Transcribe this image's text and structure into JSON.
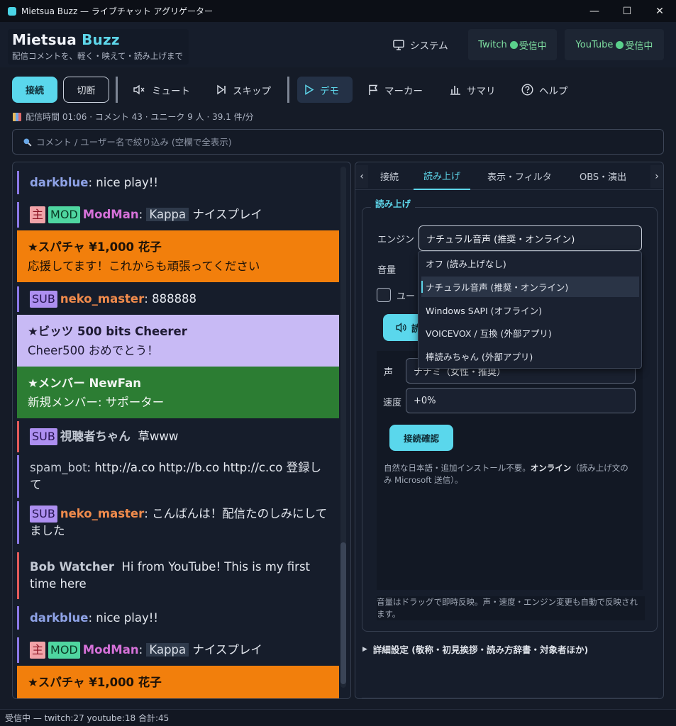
{
  "window": {
    "title": "Mietsua Buzz — ライブチャット アグリゲーター"
  },
  "brand": {
    "name": "Mietsua",
    "accent": "Buzz",
    "tagline": "配信コメントを、軽く・映えて・読み上げまで"
  },
  "header": {
    "system_label": "システム",
    "twitch_label": "Twitch",
    "twitch_status": "受信中",
    "youtube_label": "YouTube",
    "youtube_status": "受信中"
  },
  "toolbar": {
    "connect": "接続",
    "disconnect": "切断",
    "mute": "ミュート",
    "skip": "スキップ",
    "demo": "デモ",
    "marker": "マーカー",
    "summary": "サマリ",
    "help": "ヘルプ"
  },
  "stats": {
    "text": "配信時間 01:06 · コメント 43 · ユニーク 9 人 · 39.1 件/分"
  },
  "search": {
    "placeholder": "コメント / ユーザー名で絞り込み (空欄で全表示)"
  },
  "chat": {
    "m1": {
      "user": "darkblue",
      "text": ": nice play!!"
    },
    "m2": {
      "badge_host": "主",
      "badge_mod": "MOD",
      "user": "ModMan",
      "emote": "Kappa",
      "text": "ナイスプレイ"
    },
    "m3": {
      "title": "★スパチャ ¥1,000  花子",
      "text": "応援してます！これからも頑張ってください"
    },
    "m4": {
      "badge_sub": "SUB",
      "user": "neko_master",
      "text": ": 888888"
    },
    "m5": {
      "title": "★ビッツ 500 bits  Cheerer",
      "text": "Cheer500 おめでとう！"
    },
    "m6": {
      "title": "★メンバー  NewFan",
      "text": "新規メンバー: サポーター"
    },
    "m7": {
      "badge_sub": "SUB",
      "user": "視聴者ちゃん",
      "text": "草www"
    },
    "m8": {
      "user": "spam_bot",
      "text": ": http://a.co http://b.co http://c.co 登録して"
    },
    "m9": {
      "badge_sub": "SUB",
      "user": "neko_master",
      "text": ": こんばんは！配信たのしみにしてました"
    },
    "m10": {
      "user": "Bob Watcher",
      "text": "Hi from YouTube! This is my first time here"
    },
    "m11": {
      "user": "darkblue",
      "text": ": nice play!!"
    },
    "m12": {
      "badge_host": "主",
      "badge_mod": "MOD",
      "user": "ModMan",
      "emote": "Kappa",
      "text": "ナイスプレイ"
    },
    "m13": {
      "title": "★スパチャ ¥1,000  花子"
    }
  },
  "tabs": {
    "connection": "接続",
    "tts": "読み上げ",
    "display": "表示・フィルタ",
    "obs": "OBS・演出"
  },
  "tts": {
    "group_title": "読み上げ",
    "engine_label": "エンジン",
    "engine_value": "ナチュラル音声 (推奨・オンライン)",
    "volume_label": "音量",
    "checkbox_label": "ユー",
    "test_label": "読",
    "voice_label": "声",
    "voice_value": "ナナミ（女性・推奨）",
    "speed_label": "速度",
    "speed_value": "+0%",
    "confirm": "接続確認",
    "help_a": "自然な日本語・追加インストール不要。",
    "help_b": "オンライン",
    "help_c": "（読み上げ文のみ Microsoft 送信）。",
    "volume_note": "音量はドラッグで即時反映。声・速度・エンジン変更も自動で反映されます。",
    "details": "詳細設定 (敬称・初見挨拶・読み方辞書・対象者ほか)",
    "options": [
      "オフ (読み上げなし)",
      "ナチュラル音声 (推奨・オンライン)",
      "Windows SAPI (オフライン)",
      "VOICEVOX / 互換 (外部アプリ)",
      "棒読みちゃん (外部アプリ)"
    ]
  },
  "statusbar": {
    "text": "受信中 — twitch:27 youtube:18 合計:45"
  },
  "colors": {
    "accent": "#5ed6ea",
    "superchat": "#f27f0c",
    "bits": "#c8baf5",
    "member": "#2c7d33"
  }
}
